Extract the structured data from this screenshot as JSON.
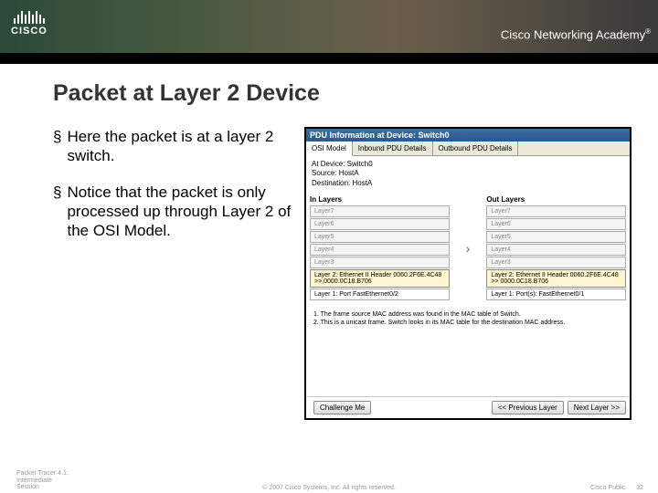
{
  "brand": {
    "name": "CISCO",
    "program": "Cisco Networking Academy",
    "tm": "®"
  },
  "slide": {
    "title": "Packet at Layer 2 Device",
    "bullets": [
      "Here the packet is at a layer 2 switch.",
      "Notice that the packet is only processed up through Layer 2 of the OSI Model."
    ]
  },
  "pdu": {
    "window_title": "PDU Information at Device: Switch0",
    "tabs": [
      "OSI Model",
      "Inbound PDU Details",
      "Outbound PDU Details"
    ],
    "active_tab": 0,
    "at_device": "At Device: Switch0",
    "source": "Source: HostA",
    "destination": "Destination: HostA",
    "in_header": "In Layers",
    "out_header": "Out Layers",
    "in_layers": [
      {
        "t": "Layer7",
        "a": false
      },
      {
        "t": "Layer6",
        "a": false
      },
      {
        "t": "Layer5",
        "a": false
      },
      {
        "t": "Layer4",
        "a": false
      },
      {
        "t": "Layer3",
        "a": false
      },
      {
        "t": "Layer 2: Ethernet II Header 0060.2F6E.4C48 >> 0000.0C18.B706",
        "a": true
      },
      {
        "t": "Layer 1: Port FastEthernet0/2",
        "a": false,
        "l1": true
      }
    ],
    "out_layers": [
      {
        "t": "Layer7",
        "a": false
      },
      {
        "t": "Layer6",
        "a": false
      },
      {
        "t": "Layer5",
        "a": false
      },
      {
        "t": "Layer4",
        "a": false
      },
      {
        "t": "Layer3",
        "a": false
      },
      {
        "t": "Layer 2: Ethernet II Header 0060.2F6E.4C48 >> 0000.0C18.B706",
        "a": true
      },
      {
        "t": "Layer 1: Port(s): FastEthernet0/1",
        "a": false,
        "l1": true
      }
    ],
    "notes": [
      "1. The frame source MAC address was found in the MAC table of Switch.",
      "2. This is a unicast frame. Switch looks in its MAC table for the destination MAC address."
    ],
    "buttons": {
      "challenge": "Challenge Me",
      "prev": "<< Previous Layer",
      "next": "Next Layer >>"
    }
  },
  "footer": {
    "left1": "Packet Tracer 4.1:",
    "left2": "Intermediate",
    "left3": "Session",
    "center": "© 2007 Cisco Systems, Inc. All rights reserved.",
    "right": "Cisco Public",
    "page": "32"
  }
}
